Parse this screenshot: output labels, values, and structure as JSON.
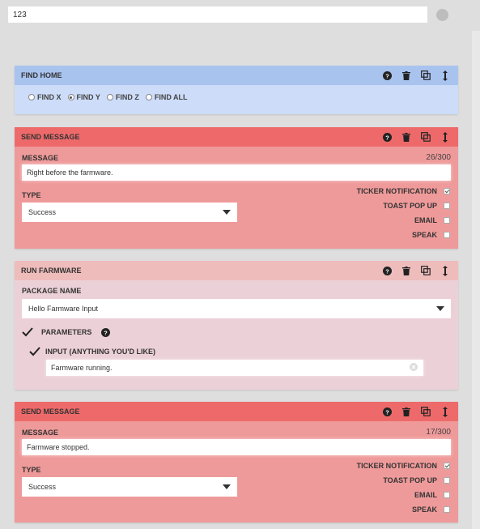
{
  "sequence": {
    "name": "123",
    "color": "#bdbdbd"
  },
  "icons": {
    "help": "help-circle-icon",
    "trash": "trash-icon",
    "copy": "copy-icon",
    "drag": "drag-vertical-icon"
  },
  "steps": [
    {
      "type": "find_home",
      "title": "FIND HOME",
      "color": "#a9c3ef",
      "options": [
        {
          "label": "FIND X",
          "selected": false
        },
        {
          "label": "FIND Y",
          "selected": true
        },
        {
          "label": "FIND Z",
          "selected": false
        },
        {
          "label": "FIND ALL",
          "selected": false
        }
      ]
    },
    {
      "type": "send_message",
      "title": "SEND MESSAGE",
      "color": "#ee6a6a",
      "message_label": "MESSAGE",
      "message": "Right before the farmware.",
      "count": "26/300",
      "type_label": "TYPE",
      "type_value": "Success",
      "channels": [
        {
          "label": "TICKER NOTIFICATION",
          "checked": true
        },
        {
          "label": "TOAST POP UP",
          "checked": false
        },
        {
          "label": "EMAIL",
          "checked": false
        },
        {
          "label": "SPEAK",
          "checked": false
        }
      ]
    },
    {
      "type": "run_farmware",
      "title": "RUN FARMWARE",
      "color": "#efbcbc",
      "package_label": "PACKAGE NAME",
      "package": "Hello Farmware Input",
      "parameters_label": "PARAMETERS",
      "parameters_checked": true,
      "input_label": "INPUT (ANYTHING YOU'D LIKE)",
      "input_checked": true,
      "input_value": "Farmware running."
    },
    {
      "type": "send_message",
      "title": "SEND MESSAGE",
      "color": "#ee6a6a",
      "message_label": "MESSAGE",
      "message": "Farmware stopped.",
      "count": "17/300",
      "type_label": "TYPE",
      "type_value": "Success",
      "channels": [
        {
          "label": "TICKER NOTIFICATION",
          "checked": true
        },
        {
          "label": "TOAST POP UP",
          "checked": false
        },
        {
          "label": "EMAIL",
          "checked": false
        },
        {
          "label": "SPEAK",
          "checked": false
        }
      ]
    }
  ]
}
